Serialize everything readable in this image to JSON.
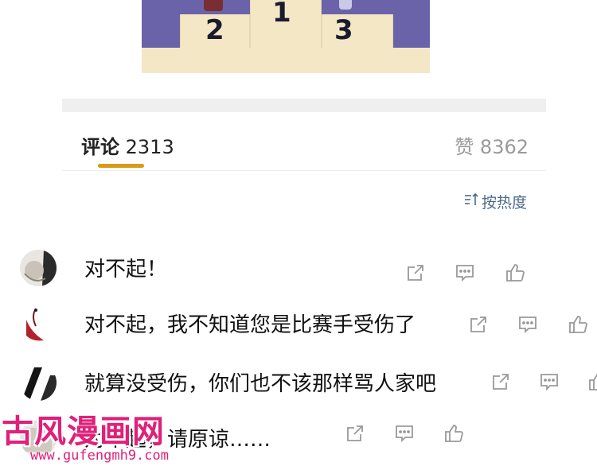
{
  "image": {
    "labels": [
      "2",
      "1",
      "3"
    ]
  },
  "tabs": {
    "comments_label": "评论",
    "comments_count": "2313",
    "likes_label": "赞",
    "likes_count": "8362"
  },
  "sort": {
    "label": "按热度",
    "icon": "sort-icon"
  },
  "comments": [
    {
      "text": "对不起！"
    },
    {
      "text": "对不起，我不知道您是比赛手受伤了"
    },
    {
      "text": "就算没受伤，你们也不该那样骂人家吧"
    },
    {
      "text": "对不起，请原谅……"
    }
  ],
  "comment_actions": [
    "share-icon",
    "reply-icon",
    "like-icon"
  ],
  "watermark": {
    "title": "古风漫画网",
    "url": "www.gufengmh9.com"
  },
  "colors": {
    "accent": "#d99a17",
    "sort_text": "#4a6a88",
    "watermark": "#e0207a"
  }
}
